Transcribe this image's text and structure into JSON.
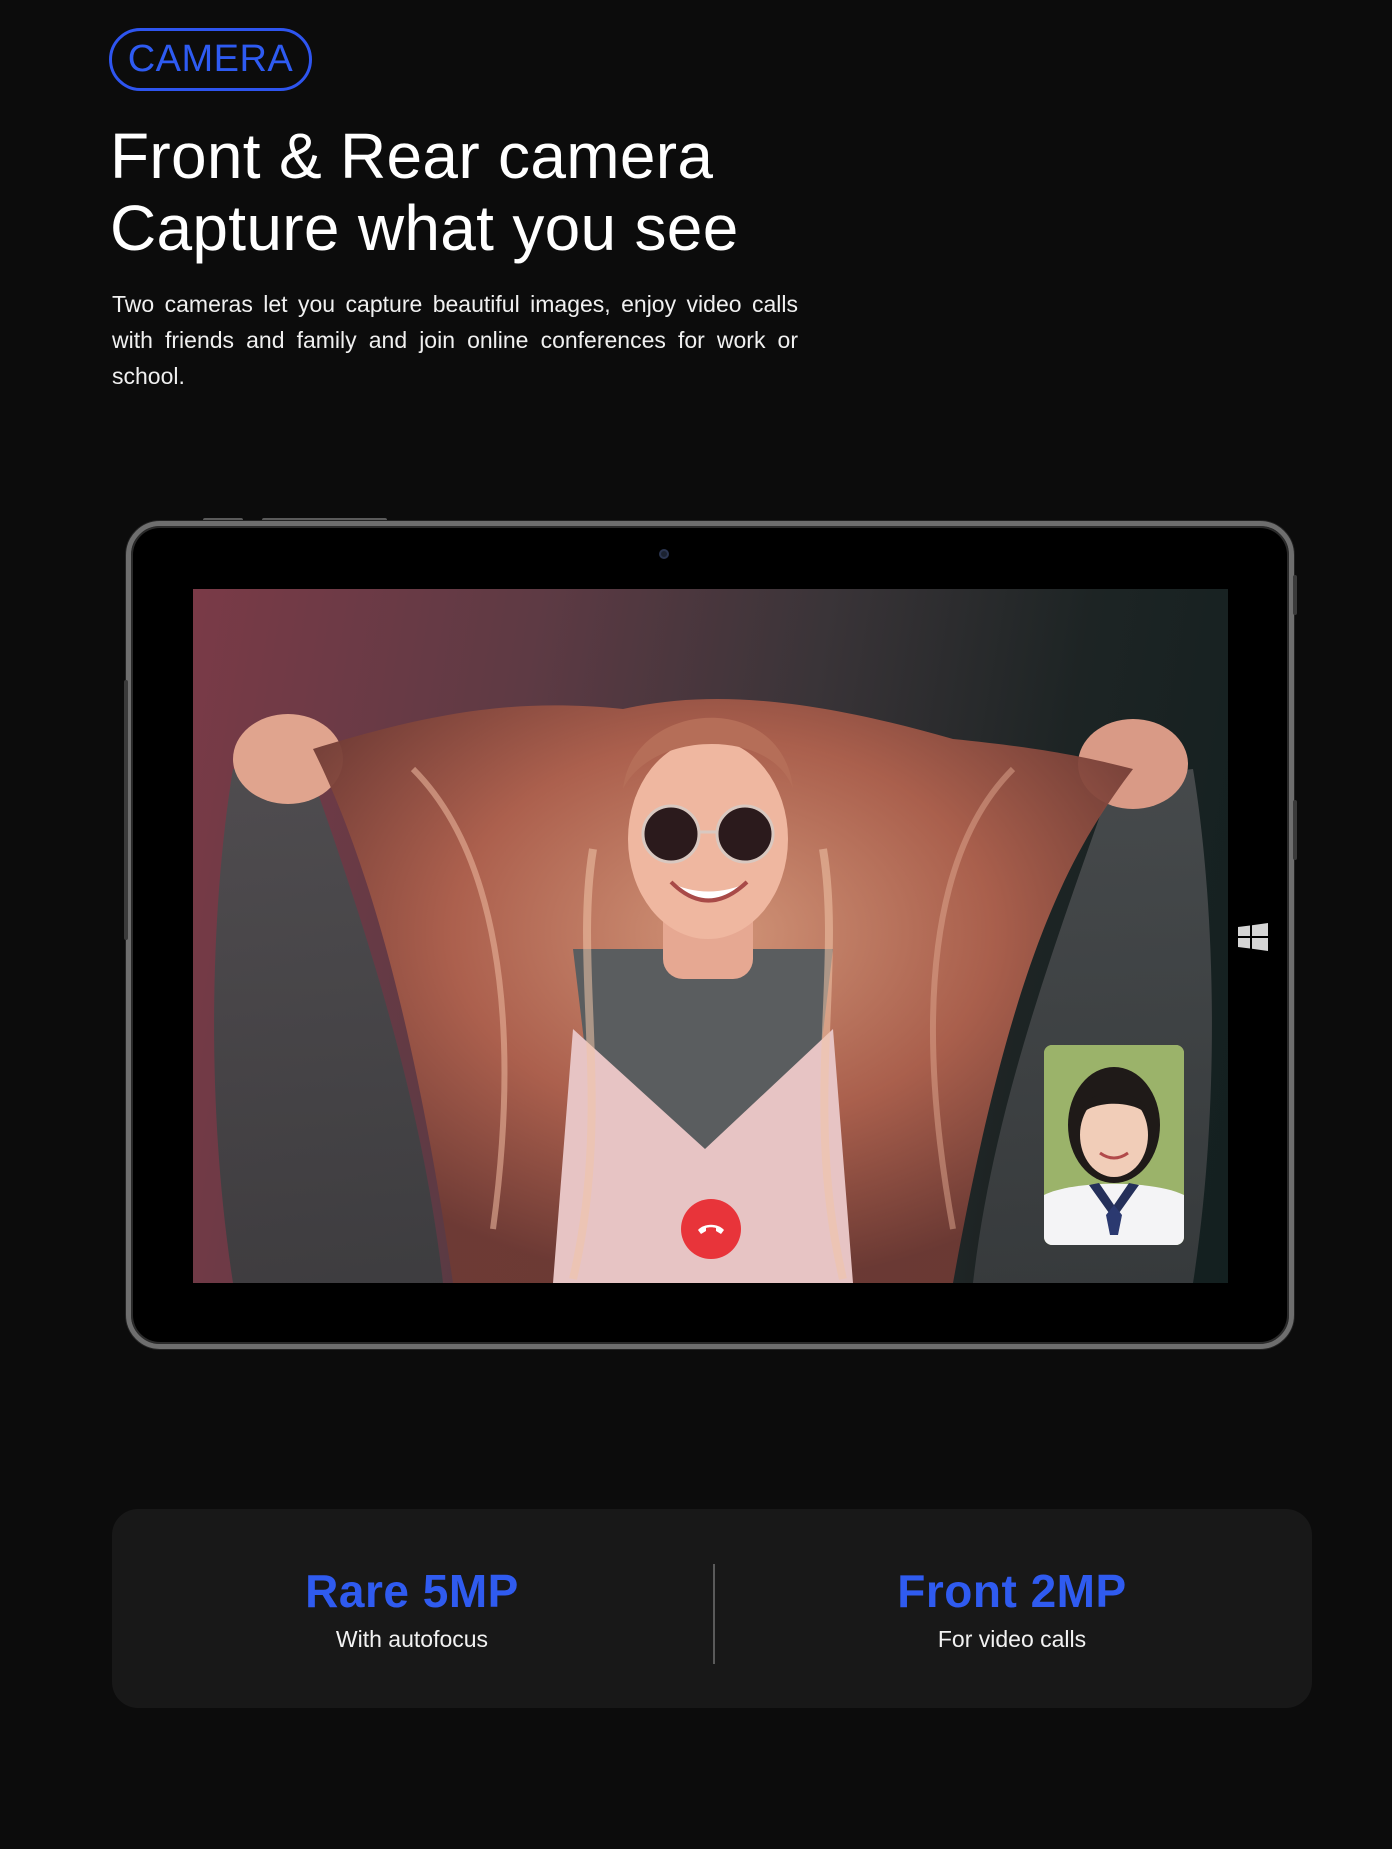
{
  "badge": "CAMERA",
  "headline": {
    "line1": "Front & Rear camera",
    "line2": "Capture what you see"
  },
  "description": "Two cameras let you capture beautiful images, enjoy video calls with friends and family and join online conferences for work or school.",
  "colors": {
    "accent": "#2e5bf2",
    "background": "#0c0c0c",
    "panel": "#181818",
    "hangup": "#e8343a"
  },
  "icons": {
    "hangup": "phone-hangup-icon",
    "windows": "windows-logo-icon",
    "camera": "front-camera-icon"
  },
  "specs": [
    {
      "title": "Rare 5MP",
      "subtitle": "With autofocus"
    },
    {
      "title": "Front 2MP",
      "subtitle": "For video calls"
    }
  ]
}
